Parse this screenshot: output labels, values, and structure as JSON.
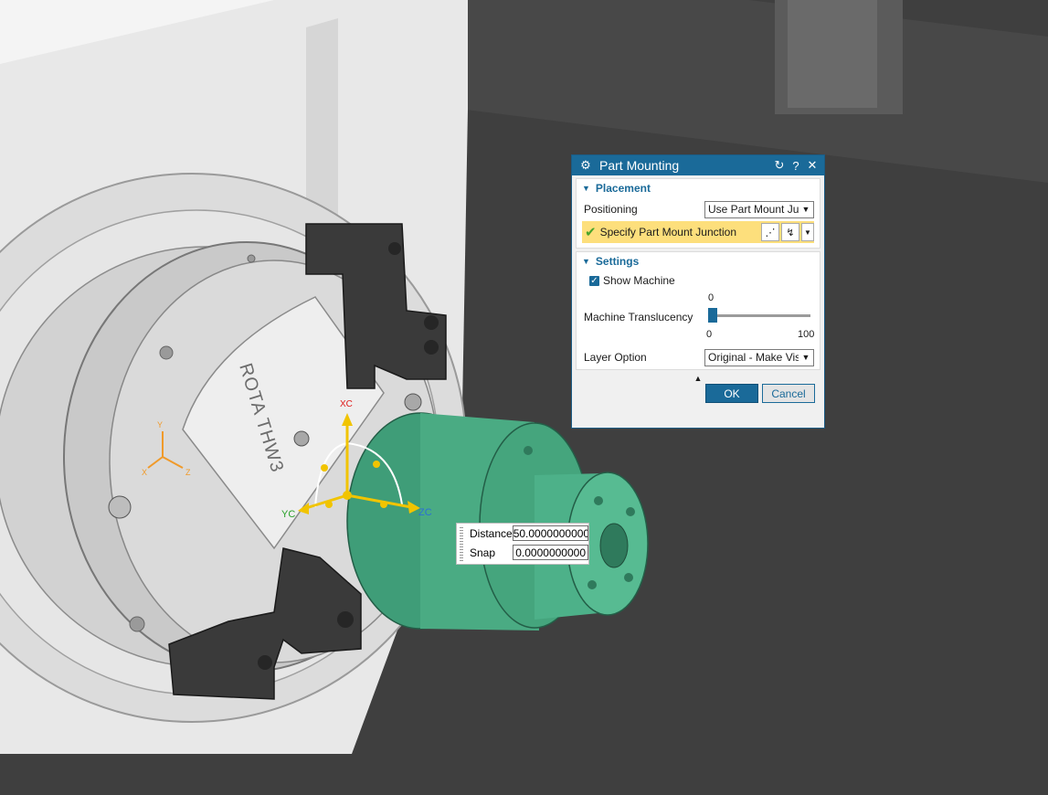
{
  "viewport": {
    "chuck_text": "ROTA THW3",
    "axis_labels": {
      "x": "XC",
      "y": "YC",
      "z": "ZC"
    },
    "triad_labels": {
      "y": "Y",
      "z": "Z",
      "x": "X"
    }
  },
  "dialog": {
    "title": "Part Mounting",
    "reset_icon": "↻",
    "help_icon": "?",
    "close_icon": "✕",
    "placement": {
      "header": "Placement",
      "positioning_label": "Positioning",
      "positioning_value": "Use Part Mount Junction",
      "specify_label": "Specify Part Mount Junction"
    },
    "settings": {
      "header": "Settings",
      "show_machine_label": "Show Machine",
      "show_machine_checked": true,
      "translucency_label": "Machine Translucency",
      "translucency_value": "0",
      "translucency_min": "0",
      "translucency_max": "100",
      "layer_label": "Layer Option",
      "layer_value": "Original - Make Visible"
    },
    "ok_label": "OK",
    "cancel_label": "Cancel"
  },
  "hud": {
    "distance_label": "Distance",
    "distance_value": "50.0000000000",
    "snap_label": "Snap",
    "snap_value": "0.0000000000"
  },
  "colors": {
    "title_bar": "#1a6a99",
    "highlight": "#fddf7c",
    "part_green": "#3f9d78",
    "jaw_dark": "#3a3a3a"
  }
}
